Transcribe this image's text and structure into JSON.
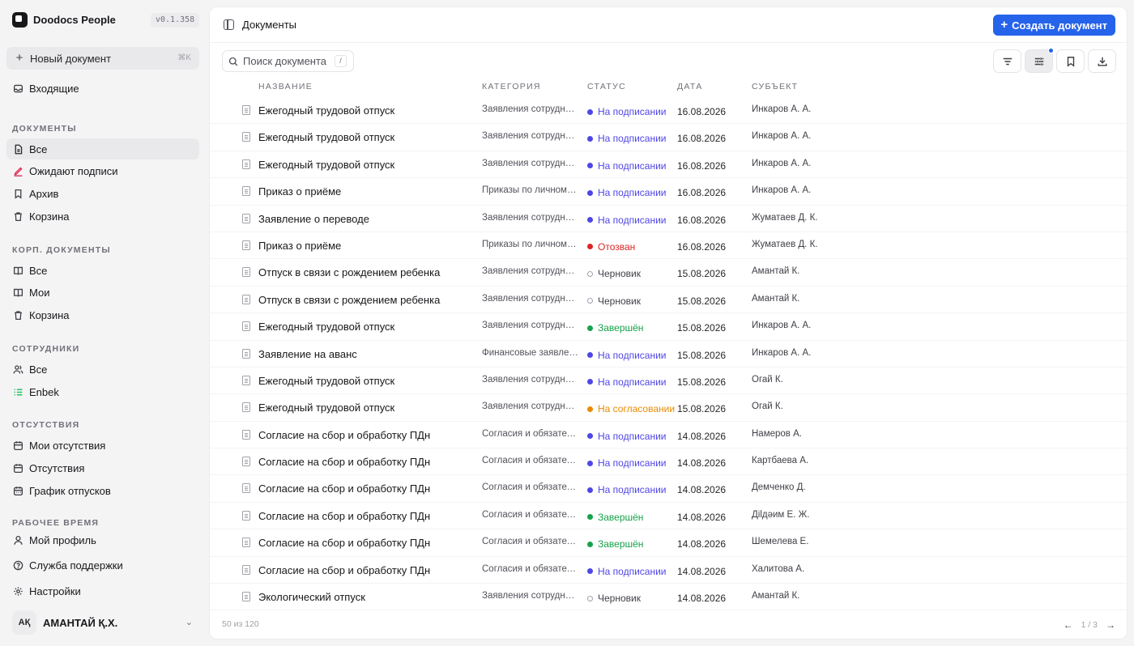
{
  "app": {
    "name": "Doodocs People",
    "version": "v0.1.358"
  },
  "sidebar": {
    "new_doc": {
      "label": "Новый документ",
      "shortcut": "⌘K"
    },
    "inbox": "Входящие",
    "sections": {
      "documents": "Документы",
      "corp": "Корп. документы",
      "employees": "Сотрудники",
      "absences": "Отсутствия",
      "worktime": "Рабочее время"
    },
    "items": {
      "doc_all": "Все",
      "doc_awaiting": "Ожидают подписи",
      "doc_archive": "Архив",
      "doc_trash": "Корзина",
      "corp_all": "Все",
      "corp_mine": "Мои",
      "corp_trash": "Корзина",
      "emp_all": "Все",
      "emp_enbek": "Enbek",
      "abs_mine": "Мои отсутствия",
      "abs_all": "Отсутствия",
      "abs_schedule": "График отпусков",
      "profile": "Мой профиль",
      "support": "Служба поддержки",
      "settings": "Настройки"
    },
    "user": {
      "initials": "АҚ",
      "name": "АМАНТАЙ Қ.Х."
    }
  },
  "header": {
    "title": "Документы",
    "create_label": "Создать документ"
  },
  "search": {
    "placeholder": "Поиск документа",
    "shortcut": "/"
  },
  "table": {
    "columns": {
      "name": "Название",
      "category": "Категория",
      "status": "Статус",
      "date": "Дата",
      "subject": "Субъект"
    },
    "status_colors": {
      "signing": "#4f46e5",
      "revoked": "#dc2626",
      "draft": "#9ca3af",
      "done": "#16a34a",
      "approval": "#ea8a00"
    },
    "rows": [
      {
        "name": "Ежегодный трудовой отпуск",
        "category": "Заявления сотрудников",
        "status": "На подписании",
        "status_key": "signing",
        "date": "16.08.2026",
        "subject": "Инкаров А. А."
      },
      {
        "name": "Ежегодный трудовой отпуск",
        "category": "Заявления сотрудников",
        "status": "На подписании",
        "status_key": "signing",
        "date": "16.08.2026",
        "subject": "Инкаров А. А."
      },
      {
        "name": "Ежегодный трудовой отпуск",
        "category": "Заявления сотрудников",
        "status": "На подписании",
        "status_key": "signing",
        "date": "16.08.2026",
        "subject": "Инкаров А. А."
      },
      {
        "name": "Приказ о приёме",
        "category": "Приказы по личному составу",
        "status": "На подписании",
        "status_key": "signing",
        "date": "16.08.2026",
        "subject": "Инкаров А. А."
      },
      {
        "name": "Заявление о переводе",
        "category": "Заявления сотрудников",
        "status": "На подписании",
        "status_key": "signing",
        "date": "16.08.2026",
        "subject": "Жуматаев Д. К."
      },
      {
        "name": "Приказ о приёме",
        "category": "Приказы по личному составу",
        "status": "Отозван",
        "status_key": "revoked",
        "date": "16.08.2026",
        "subject": "Жуматаев Д. К."
      },
      {
        "name": "Отпуск в связи с рождением ребенка",
        "category": "Заявления сотрудников",
        "status": "Черновик",
        "status_key": "draft",
        "date": "15.08.2026",
        "subject": "Амантай К."
      },
      {
        "name": "Отпуск в связи с рождением ребенка",
        "category": "Заявления сотрудников",
        "status": "Черновик",
        "status_key": "draft",
        "date": "15.08.2026",
        "subject": "Амантай К."
      },
      {
        "name": "Ежегодный трудовой отпуск",
        "category": "Заявления сотрудников",
        "status": "Завершён",
        "status_key": "done",
        "date": "15.08.2026",
        "subject": "Инкаров А. А."
      },
      {
        "name": "Заявление на аванс",
        "category": "Финансовые заявления",
        "status": "На подписании",
        "status_key": "signing",
        "date": "15.08.2026",
        "subject": "Инкаров А. А."
      },
      {
        "name": "Ежегодный трудовой отпуск",
        "category": "Заявления сотрудников",
        "status": "На подписании",
        "status_key": "signing",
        "date": "15.08.2026",
        "subject": "Огай К."
      },
      {
        "name": "Ежегодный трудовой отпуск",
        "category": "Заявления сотрудников",
        "status": "На согласовании",
        "status_key": "approval",
        "date": "15.08.2026",
        "subject": "Огай К."
      },
      {
        "name": "Согласие на сбор и обработку ПДн",
        "category": "Согласия и обязательства",
        "status": "На подписании",
        "status_key": "signing",
        "date": "14.08.2026",
        "subject": "Намеров А."
      },
      {
        "name": "Согласие на сбор и обработку ПДн",
        "category": "Согласия и обязательства",
        "status": "На подписании",
        "status_key": "signing",
        "date": "14.08.2026",
        "subject": "Картбаева А."
      },
      {
        "name": "Согласие на сбор и обработку ПДн",
        "category": "Согласия и обязательства",
        "status": "На подписании",
        "status_key": "signing",
        "date": "14.08.2026",
        "subject": "Демченко Д."
      },
      {
        "name": "Согласие на сбор и обработку ПДн",
        "category": "Согласия и обязательства",
        "status": "Завершён",
        "status_key": "done",
        "date": "14.08.2026",
        "subject": "Діlдәим Е. Ж."
      },
      {
        "name": "Согласие на сбор и обработку ПДн",
        "category": "Согласия и обязательства",
        "status": "Завершён",
        "status_key": "done",
        "date": "14.08.2026",
        "subject": "Шемелева Е."
      },
      {
        "name": "Согласие на сбор и обработку ПДн",
        "category": "Согласия и обязательства",
        "status": "На подписании",
        "status_key": "signing",
        "date": "14.08.2026",
        "subject": "Халитова А."
      },
      {
        "name": "Экологический отпуск",
        "category": "Заявления сотрудников",
        "status": "Черновик",
        "status_key": "draft",
        "date": "14.08.2026",
        "subject": "Амантай К."
      }
    ]
  },
  "footer": {
    "count": "50 из 120",
    "page": "1 / 3",
    "prev": "←",
    "next": "→"
  }
}
